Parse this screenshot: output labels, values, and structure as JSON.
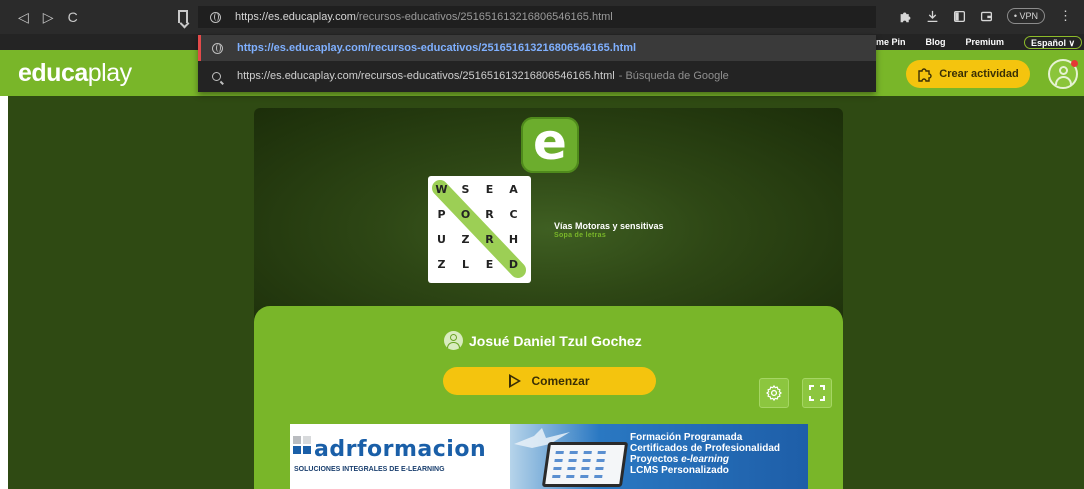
{
  "browser": {
    "nav": {
      "back": "◁",
      "forward": "▷",
      "reload": "C"
    },
    "url_domain": "https://es.educaplay.com",
    "url_path": "/recursos-educativos/251651613216806546165.html",
    "suggestion_1": "https://es.educaplay.com/recursos-educativos/251651613216806546165.html",
    "suggestion_2": "https://es.educaplay.com/recursos-educativos/251651613216806546165.html",
    "suggestion_2_suffix": "- Búsqueda de Google",
    "vpn_label": "• VPN",
    "extension_icon": "puzzle-icon",
    "download_icon": "download-icon"
  },
  "site_nav": {
    "items": [
      "me Pin",
      "Blog",
      "Premium"
    ],
    "language": "Español ∨"
  },
  "header": {
    "logo_bold": "educa",
    "logo_light": "play",
    "create_button": "Crear actividad"
  },
  "activity": {
    "logo_letter": "e",
    "grid": [
      [
        "W",
        "S",
        "E",
        "A"
      ],
      [
        "P",
        "O",
        "R",
        "C"
      ],
      [
        "U",
        "Z",
        "R",
        "H"
      ],
      [
        "Z",
        "L",
        "E",
        "D"
      ]
    ],
    "title": "Vías Motoras y sensitivas",
    "type": "Sopa de letras"
  },
  "panel": {
    "author": "Josué Daniel Tzul Gochez",
    "start_button": "Comenzar"
  },
  "ad": {
    "brand": "adrformacion",
    "tagline": "SOLUCIONES INTEGRALES DE E-LEARNING",
    "line1": "Formación Programada",
    "line2": "Certificados de Profesionalidad",
    "line3_prefix": "Proyectos ",
    "line3_em": "e-learning",
    "line4": "LCMS Personalizado"
  },
  "colors": {
    "brand_green": "#79b629",
    "dark_bg": "#2f4a13",
    "yellow": "#f4c40e"
  }
}
